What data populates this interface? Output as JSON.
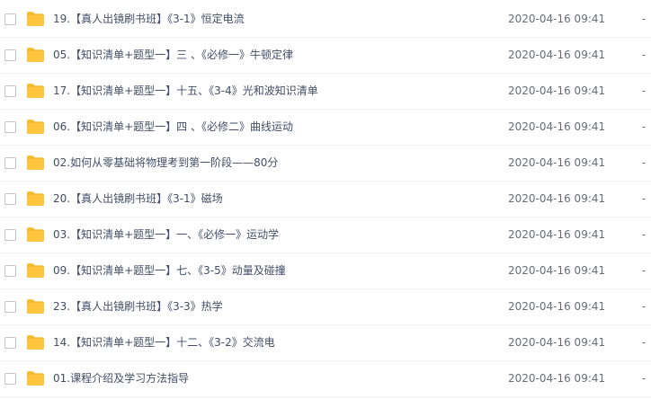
{
  "files": [
    {
      "name": "19.【真人出镜刷书班】《3-1》恒定电流",
      "date": "2020-04-16 09:41",
      "size": "-"
    },
    {
      "name": "05.【知识清单+题型一】三 、《必修一》牛顿定律",
      "date": "2020-04-16 09:41",
      "size": "-"
    },
    {
      "name": "17.【知识清单+题型一】十五、《3-4》光和波知识清单",
      "date": "2020-04-16 09:41",
      "size": "-"
    },
    {
      "name": "06.【知识清单+题型一】四 、《必修二》曲线运动",
      "date": "2020-04-16 09:41",
      "size": "-"
    },
    {
      "name": "02.如何从零基础将物理考到第一阶段——80分",
      "date": "2020-04-16 09:41",
      "size": "-"
    },
    {
      "name": "20.【真人出镜刷书班】《3-1》磁场",
      "date": "2020-04-16 09:41",
      "size": "-"
    },
    {
      "name": "03.【知识清单+题型一】一、《必修一》运动学",
      "date": "2020-04-16 09:41",
      "size": "-"
    },
    {
      "name": "09.【知识清单+题型一】七、《3-5》动量及碰撞",
      "date": "2020-04-16 09:41",
      "size": "-"
    },
    {
      "name": "23.【真人出镜刷书班】《3-3》热学",
      "date": "2020-04-16 09:41",
      "size": "-"
    },
    {
      "name": "14.【知识清单+题型一】十二、《3-2》交流电",
      "date": "2020-04-16 09:41",
      "size": "-"
    },
    {
      "name": "01.课程介绍及学习方法指导",
      "date": "2020-04-16 09:41",
      "size": "-"
    }
  ],
  "icon": "folder-icon",
  "colors": {
    "folder": "#ffc63d",
    "folder_tab": "#f5b72b",
    "name_text": "#424e67",
    "date_text": "#666c78"
  }
}
